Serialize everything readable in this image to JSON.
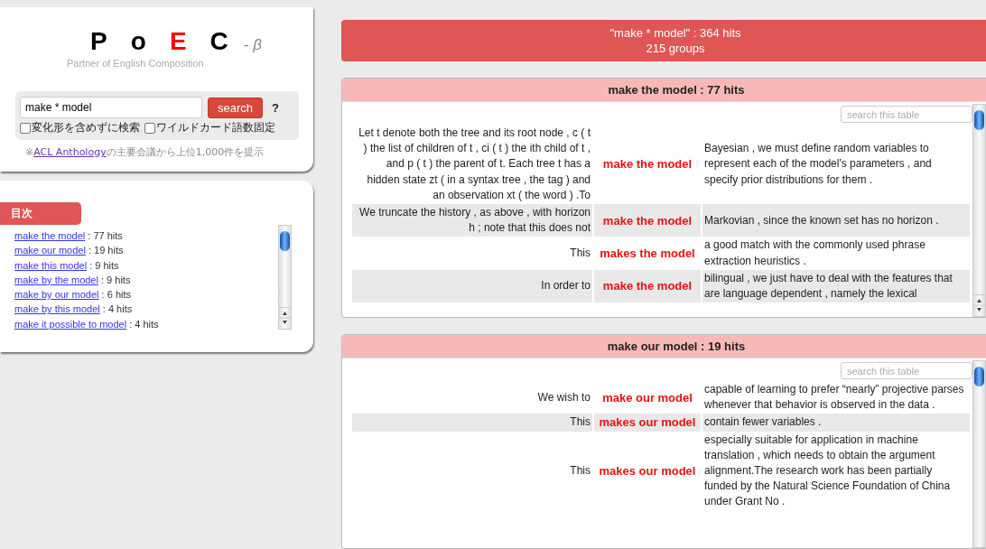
{
  "logo": {
    "letters": [
      {
        "char": "P",
        "highlight": false
      },
      {
        "char": "o",
        "highlight": false
      },
      {
        "char": "E",
        "highlight": true
      },
      {
        "char": "C",
        "highlight": false
      }
    ],
    "suffix": "- β",
    "subtitle": "Partner of English Composition"
  },
  "search": {
    "value": "make * model",
    "button": "search",
    "help": "?",
    "options": [
      {
        "label": "変化形を含めずに検索",
        "checked": false
      },
      {
        "label": "ワイルドカード語数固定",
        "checked": false
      }
    ]
  },
  "note": {
    "prefix": "※",
    "link": "ACL Anthology",
    "suffix": "の主要会議から上位1,000件を提示"
  },
  "toc": {
    "title": "目次",
    "items": [
      {
        "link": "make the model",
        "count": " : 77 hits"
      },
      {
        "link": "make our model",
        "count": " : 19 hits"
      },
      {
        "link": "make this model",
        "count": " : 9 hits"
      },
      {
        "link": "make by the model",
        "count": " : 9 hits"
      },
      {
        "link": "make by our model",
        "count": " : 6 hits"
      },
      {
        "link": "make by this model",
        "count": " : 4 hits"
      },
      {
        "link": "make it possible to model",
        "count": " : 4 hits"
      }
    ]
  },
  "summary": {
    "hits": "\"make * model\" : 364 hits",
    "groups": "215 groups"
  },
  "groups": [
    {
      "title": "make the model : 77 hits",
      "filter_placeholder": "search this table",
      "rows": [
        {
          "left": "Let t denote both the tree and its root node , c ( t ) the list of children of t , ci ( t ) the ith child of t , and p ( t ) the parent of t. Each tree t has a hidden state zt ( in a syntax tree , the tag ) and an observation xt ( the word ) .To",
          "match": "make the model",
          "right": "Bayesian , we must define random variables to represent each of the model's parameters , and specify prior distributions for them ."
        },
        {
          "left": "We truncate the history , as above , with horizon h ; note that this does not",
          "match": "make the model",
          "right": "Markovian , since the known set has no horizon ."
        },
        {
          "left": "This",
          "match": "makes the model",
          "right": "a good match with the commonly used phrase extraction heuristics ."
        },
        {
          "left": "In order to",
          "match": "make the model",
          "right": "bilingual , we just have to deal with the features that are language dependent , namely the lexical"
        }
      ]
    },
    {
      "title": "make our model : 19 hits",
      "filter_placeholder": "search this table",
      "rows": [
        {
          "left": "We wish to",
          "match": "make our model",
          "right": "capable of learning to prefer “nearly” projective parses whenever that behavior is observed in the data ."
        },
        {
          "left": "This",
          "match": "makes our model",
          "right": "contain fewer variables ."
        },
        {
          "left": "This",
          "match": "makes our model",
          "right": "especially suitable for application in machine translation , which needs to obtain the argument alignment.The research work has been partially funded by the Natural Science Foundation of China under Grant No ."
        }
      ]
    }
  ]
}
